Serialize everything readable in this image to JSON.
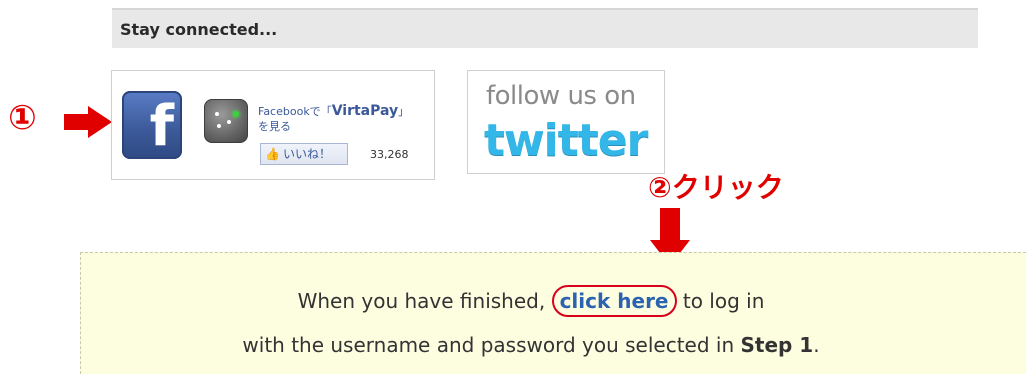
{
  "header": {
    "title": "Stay connected..."
  },
  "markers": {
    "step1": "①",
    "step2": "②クリック"
  },
  "facebook": {
    "line1_prefix": "Facebookで「",
    "line1_brand": "VirtaPay",
    "line1_suffix": "」",
    "line2": "を見る",
    "like_label": "いいね！",
    "like_count": "33,268",
    "icon": "facebook-logo"
  },
  "twitter": {
    "follow_text": "follow us on",
    "brand_text": "twitter",
    "icon": "twitter-logo"
  },
  "notice": {
    "line1_before": "When you have finished, ",
    "link_text": "click here",
    "line1_after": " to log in",
    "line2_before": "with the username and password you selected in ",
    "line2_bold": "Step 1",
    "line2_after": "."
  },
  "colors": {
    "marker_red": "#e00000",
    "link_blue": "#2b63b0",
    "notice_bg": "#fdfde0",
    "facebook_blue": "#3b5998",
    "twitter_blue": "#33b6e8"
  }
}
